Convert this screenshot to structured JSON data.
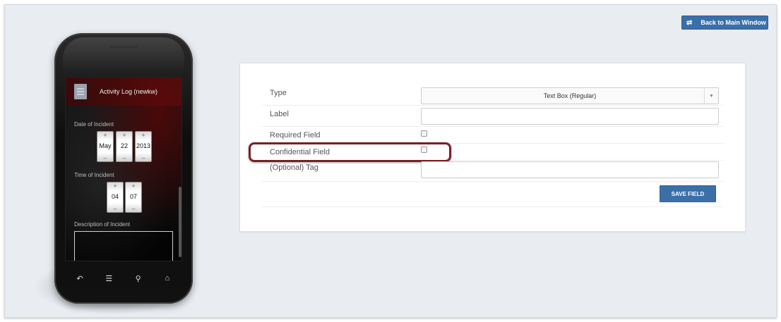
{
  "header": {
    "back_button_icon": "swap-arrows-icon",
    "back_button_label": "Back to Main Window"
  },
  "phone": {
    "app_title": "Activity Log (newkw)",
    "app_icon": "document-icon",
    "date_label": "Date of Incident",
    "date_month": "May",
    "date_day": "22",
    "date_year": "2013",
    "time_label": "Time of Incident",
    "time_hour": "04",
    "time_minute": "07",
    "description_label": "Description of Incident",
    "spinner_plus": "+",
    "spinner_minus": "–",
    "nav_icons": [
      "back-icon",
      "menu-icon",
      "search-icon",
      "home-icon"
    ]
  },
  "form": {
    "type_label": "Type",
    "type_value": "Text Box (Regular)",
    "label_label": "Label",
    "label_value": "",
    "required_label": "Required Field",
    "required_checked": false,
    "confidential_label": "Confidential Field",
    "confidential_checked": false,
    "tag_label": "(Optional) Tag",
    "tag_value": "",
    "save_label": "SAVE FIELD"
  },
  "colors": {
    "accent": "#3b6fa8",
    "highlight": "#7a1f24",
    "background": "#e9ecf1"
  }
}
